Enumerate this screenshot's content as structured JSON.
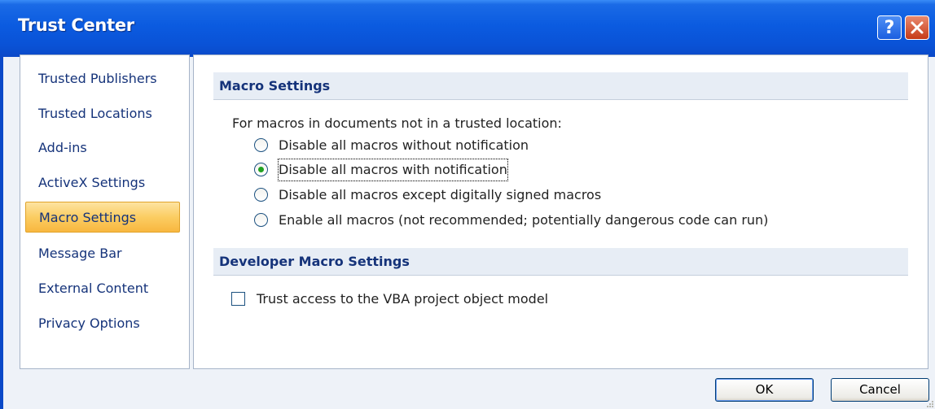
{
  "window": {
    "title": "Trust Center"
  },
  "titlebar_buttons": {
    "help": "?",
    "close": "X"
  },
  "sidebar": {
    "items": [
      {
        "label": "Trusted Publishers",
        "selected": false
      },
      {
        "label": "Trusted Locations",
        "selected": false
      },
      {
        "label": "Add-ins",
        "selected": false
      },
      {
        "label": "ActiveX Settings",
        "selected": false
      },
      {
        "label": "Macro Settings",
        "selected": true
      },
      {
        "label": "Message Bar",
        "selected": false
      },
      {
        "label": "External Content",
        "selected": false
      },
      {
        "label": "Privacy Options",
        "selected": false
      }
    ]
  },
  "macro_settings": {
    "header": "Macro Settings",
    "intro": "For macros in documents not in a trusted location:",
    "options": [
      {
        "label": "Disable all macros without notification",
        "checked": false
      },
      {
        "label": "Disable all macros with notification",
        "checked": true
      },
      {
        "label": "Disable all macros except digitally signed macros",
        "checked": false
      },
      {
        "label": "Enable all macros (not recommended; potentially dangerous code can run)",
        "checked": false
      }
    ]
  },
  "developer_settings": {
    "header": "Developer Macro Settings",
    "vba_label": "Trust access to the VBA project object model",
    "vba_checked": false
  },
  "footer": {
    "ok": "OK",
    "cancel": "Cancel"
  },
  "colors": {
    "titlebar": "#0b5be0",
    "selected_item": "#fbcd62",
    "header_text": "#15337a"
  }
}
